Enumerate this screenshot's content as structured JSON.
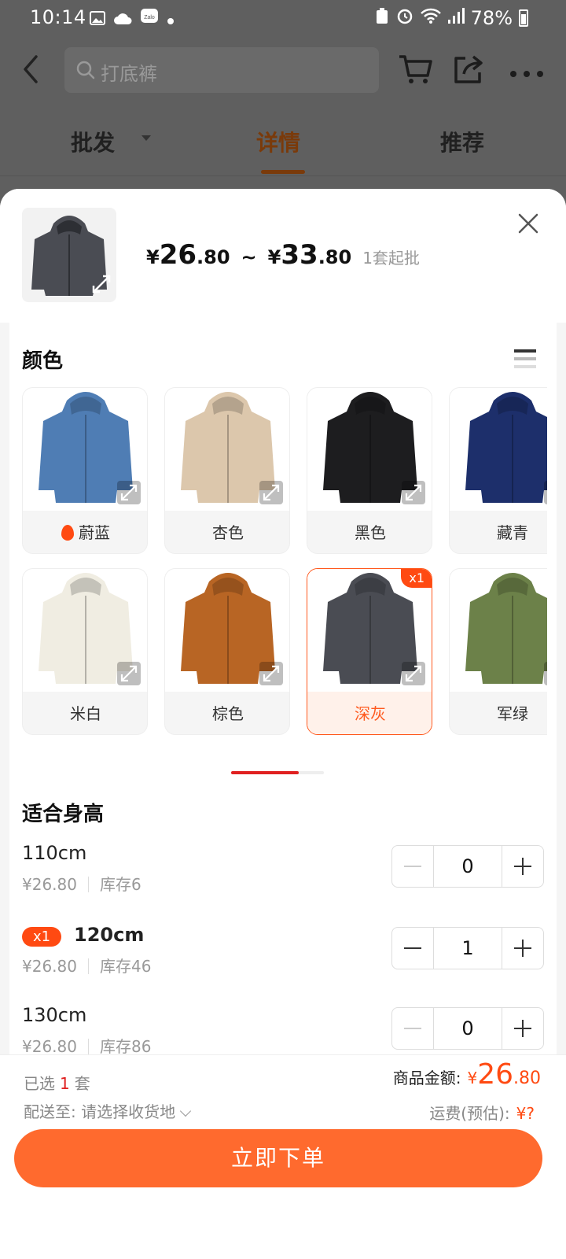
{
  "status": {
    "time": "10:14",
    "battery": "78%"
  },
  "header": {
    "search_placeholder": "打底裤"
  },
  "tabs": [
    {
      "label": "批发"
    },
    {
      "label": "详情"
    },
    {
      "label": "推荐"
    }
  ],
  "product": {
    "price_min_cur": "¥",
    "price_min_int": "26",
    "price_min_dec": ".80",
    "tilde": "~",
    "price_max_cur": "¥",
    "price_max_int": "33",
    "price_max_dec": ".80",
    "moq": "1套起批"
  },
  "color_section": {
    "title": "颜色",
    "items": [
      {
        "name": "蔚蓝",
        "hot": true,
        "color": "#4f7db4"
      },
      {
        "name": "杏色",
        "color": "#dcc7ac"
      },
      {
        "name": "黑色",
        "color": "#1d1d1f"
      },
      {
        "name": "藏青",
        "color": "#1d2f6b"
      },
      {
        "name": "米白",
        "color": "#f0ede2"
      },
      {
        "name": "棕色",
        "color": "#b86524"
      },
      {
        "name": "深灰",
        "color": "#4a4c53",
        "selected": true,
        "badge": "x1"
      },
      {
        "name": "军绿",
        "color": "#6c8149"
      }
    ]
  },
  "size_section": {
    "title": "适合身高",
    "rows": [
      {
        "label": "110cm",
        "price": "¥26.80",
        "stock": "库存6",
        "qty": "0"
      },
      {
        "label": "120cm",
        "price": "¥26.80",
        "stock": "库存46",
        "qty": "1",
        "badge": "x1"
      },
      {
        "label": "130cm",
        "price": "¥26.80",
        "stock": "库存86",
        "qty": "0"
      }
    ]
  },
  "summary": {
    "selected_prefix": "已选",
    "selected_count": "1",
    "selected_unit": "套",
    "ship_label": "配送至:",
    "ship_value": "请选择收货地",
    "total_label": "商品金额:",
    "total_cur": "¥",
    "total_int": "26",
    "total_dec": ".80",
    "freight_label": "运费(预估):",
    "freight_value": "¥?",
    "order_button": "立即下单"
  }
}
